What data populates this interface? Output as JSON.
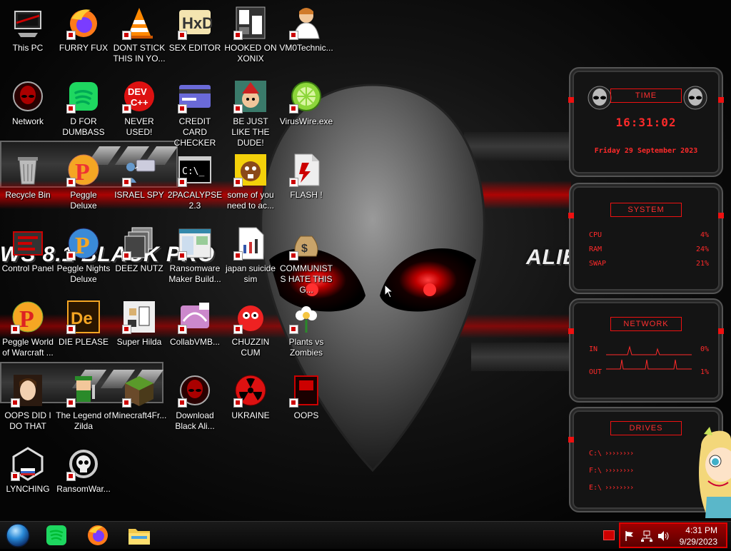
{
  "desktop": {
    "wallpaper": {
      "text_left": "WS 8.1 BLACK PRO",
      "text_right": "ALIEN EDITION",
      "accent": "#ff1a1a"
    },
    "icons": [
      {
        "label": "This PC",
        "icon": "computer-icon"
      },
      {
        "label": "FURRY FUX",
        "icon": "firefox-icon"
      },
      {
        "label": "DONT STICK THIS IN YO...",
        "icon": "vlc-cone-icon"
      },
      {
        "label": "SEX EDITOR",
        "icon": "hxd-icon"
      },
      {
        "label": "HOOKED ON XONIX",
        "icon": "xonix-icon"
      },
      {
        "label": "VM0Technic...",
        "icon": "doctor-icon"
      },
      {
        "label": "Network",
        "icon": "network-icon"
      },
      {
        "label": "D FOR DUMBASS",
        "icon": "spotify-icon"
      },
      {
        "label": "NEVER USED!",
        "icon": "devcpp-icon"
      },
      {
        "label": "CREDIT CARD CHECKER",
        "icon": "credit-card-icon"
      },
      {
        "label": "BE JUST LIKE THE DUDE!",
        "icon": "elf-icon"
      },
      {
        "label": "VirusWire.exe",
        "icon": "limewire-icon"
      },
      {
        "label": "Recycle Bin",
        "icon": "recycle-bin-icon"
      },
      {
        "label": "Peggle Deluxe",
        "icon": "peggle-icon"
      },
      {
        "label": "ISRAEL SPY",
        "icon": "spy-network-icon"
      },
      {
        "label": "2PACALYPSE 2.3",
        "icon": "terminal-icon"
      },
      {
        "label": "some of you need to ac...",
        "icon": "beaver-icon"
      },
      {
        "label": "FLASH !",
        "icon": "flash-file-icon"
      },
      {
        "label": "Control Panel",
        "icon": "control-panel-icon"
      },
      {
        "label": "Peggle Nights Deluxe",
        "icon": "peggle-nights-icon"
      },
      {
        "label": "DEEZ NUTZ",
        "icon": "window-stack-icon"
      },
      {
        "label": "Ransomware Maker Build...",
        "icon": "app-window-icon"
      },
      {
        "label": "japan suicide sim",
        "icon": "document-icon"
      },
      {
        "label": "COMMUNISTS HATE THIS G...",
        "icon": "money-bag-icon"
      },
      {
        "label": "Peggle World of Warcraft ...",
        "icon": "peggle-wow-icon"
      },
      {
        "label": "DIE PLEASE",
        "icon": "adobe-de-icon"
      },
      {
        "label": "Super Hilda",
        "icon": "pixel-dog-icon"
      },
      {
        "label": "CollabVMB...",
        "icon": "collab-icon"
      },
      {
        "label": "CHUZZIN CUM",
        "icon": "chuzzle-icon"
      },
      {
        "label": "Plants vs Zombies",
        "icon": "flower-icon"
      },
      {
        "label": "OOPS DID I DO THAT",
        "icon": "portrait-icon"
      },
      {
        "label": "The Legend of Zilda",
        "icon": "pixel-hero-icon"
      },
      {
        "label": "Minecraft4Fr...",
        "icon": "grass-block-icon"
      },
      {
        "label": "Download Black Ali...",
        "icon": "alien-orb-icon"
      },
      {
        "label": "UKRAINE",
        "icon": "radiation-icon"
      },
      {
        "label": "OOPS",
        "icon": "red-book-icon"
      },
      {
        "label": "LYNCHING",
        "icon": "hex-ribbon-icon"
      },
      {
        "label": "RansomWar...",
        "icon": "skull-ring-icon"
      }
    ]
  },
  "gadgets": {
    "time": {
      "header": "TIME",
      "clock": "16:31:02",
      "date": "Friday 29 September 2023"
    },
    "system": {
      "header": "SYSTEM",
      "rows": [
        {
          "label": "CPU",
          "value": "4%"
        },
        {
          "label": "RAM",
          "value": "24%"
        },
        {
          "label": "SWAP",
          "value": "21%"
        }
      ]
    },
    "network": {
      "header": "NETWORK",
      "rows": [
        {
          "label": "IN",
          "value": "0%"
        },
        {
          "label": "OUT",
          "value": "1%"
        }
      ]
    },
    "drives": {
      "header": "DRIVES",
      "rows": [
        {
          "label": "C:\\",
          "value": "3"
        },
        {
          "label": "F:\\",
          "value": "1"
        },
        {
          "label": "E:\\",
          "value": ""
        }
      ]
    }
  },
  "taskbar": {
    "pinned": [
      {
        "icon": "start-orb-icon"
      },
      {
        "icon": "spotify-icon"
      },
      {
        "icon": "firefox-icon"
      },
      {
        "icon": "file-explorer-icon"
      }
    ],
    "tray": {
      "time": "4:31 PM",
      "date": "9/29/2023"
    },
    "colors": {
      "tray_bg": "#8a0000",
      "tray_border": "#dd0000"
    }
  }
}
